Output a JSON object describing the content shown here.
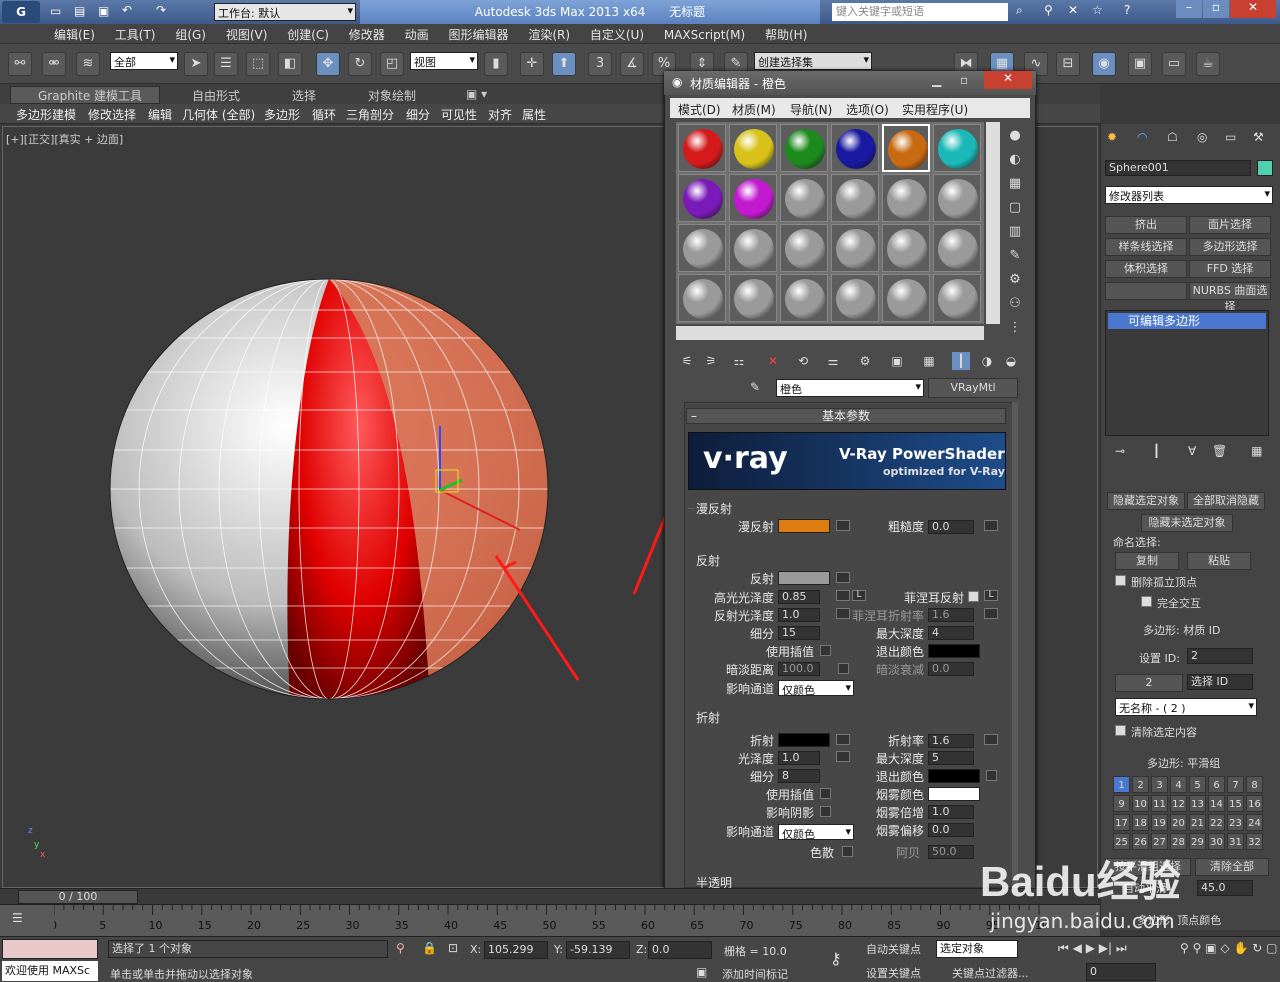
{
  "window": {
    "workspace_label": "工作台: 默认",
    "app_title": "Autodesk 3ds Max  2013 x64",
    "doc_title": "无标题",
    "search_placeholder": "键入关键字或短语"
  },
  "menu": [
    "编辑(E)",
    "工具(T)",
    "组(G)",
    "视图(V)",
    "创建(C)",
    "修改器",
    "动画",
    "图形编辑器",
    "渲染(R)",
    "自定义(U)",
    "MAXScript(M)",
    "帮助(H)"
  ],
  "toolbar": {
    "selection_filter": "全部",
    "ref_coord": "视图",
    "named_selection": "创建选择集",
    "snap_number": "3",
    "percent_label": "%"
  },
  "ribbon": {
    "tabs": [
      "Graphite 建模工具",
      "自由形式",
      "选择",
      "对象绘制"
    ],
    "tools": [
      "多边形建模",
      "修改选择",
      "编辑",
      "几何体 (全部)",
      "多边形",
      "循环",
      "三角剖分",
      "细分",
      "可见性",
      "对齐",
      "属性"
    ]
  },
  "viewport": {
    "label": "[+][正交][真实 + 边面]",
    "axis": {
      "x": "x",
      "y": "y",
      "z": "z"
    }
  },
  "material_editor": {
    "title": "材质编辑器 - 橙色",
    "menu": [
      "模式(D)",
      "材质(M)",
      "导航(N)",
      "选项(O)",
      "实用程序(U)"
    ],
    "slots": [
      {
        "color": "#d41a1a"
      },
      {
        "color": "#d8c21a"
      },
      {
        "color": "#1d8a1d"
      },
      {
        "color": "#1a1aa0"
      },
      {
        "color": "#c86a12",
        "selected": true
      },
      {
        "color": "#1ab8b8"
      },
      {
        "color": "#7a1ab8"
      },
      {
        "color": "#c21ad0"
      },
      {
        "color": "#9a9a9a"
      },
      {
        "color": "#9a9a9a"
      },
      {
        "color": "#9a9a9a"
      },
      {
        "color": "#9a9a9a"
      },
      {
        "color": "#9a9a9a"
      },
      {
        "color": "#9a9a9a"
      },
      {
        "color": "#9a9a9a"
      },
      {
        "color": "#9a9a9a"
      },
      {
        "color": "#9a9a9a"
      },
      {
        "color": "#9a9a9a"
      },
      {
        "color": "#9a9a9a"
      },
      {
        "color": "#9a9a9a"
      },
      {
        "color": "#9a9a9a"
      },
      {
        "color": "#9a9a9a"
      },
      {
        "color": "#9a9a9a"
      },
      {
        "color": "#9a9a9a"
      }
    ],
    "material_name": "橙色",
    "material_type": "VRayMtl",
    "rollout_title": "基本参数",
    "vray_banner": {
      "logo": "v·ray",
      "title": "V-Ray PowerShader",
      "subtitle": "optimized for V-Ray"
    },
    "diffuse": {
      "group": "漫反射",
      "diffuse_label": "漫反射",
      "diffuse_color": "#e07d10",
      "roughness_label": "粗糙度",
      "roughness": "0.0"
    },
    "reflection": {
      "group": "反射",
      "reflect_label": "反射",
      "reflect_color": "#9a9a9a",
      "hilight_gloss_label": "高光光泽度",
      "hilight_gloss": "0.85",
      "lock_label": "L",
      "fresnel_label": "菲涅耳反射",
      "refl_gloss_label": "反射光泽度",
      "refl_gloss": "1.0",
      "fresnel_ior_label": "菲涅耳折射率",
      "fresnel_ior": "1.6",
      "subdivs_label": "细分",
      "subdivs": "15",
      "max_depth_label": "最大深度",
      "max_depth": "4",
      "interp_label": "使用插值",
      "exit_color_label": "退出颜色",
      "exit_color": "#000000",
      "dim_dist_label": "暗淡距离",
      "dim_dist": "100.0",
      "dim_falloff_label": "暗淡衰减",
      "dim_falloff": "0.0",
      "affect_label": "影响通道",
      "affect": "仅颜色"
    },
    "refraction": {
      "group": "折射",
      "refract_label": "折射",
      "refract_color": "#000000",
      "ior_label": "折射率",
      "ior": "1.6",
      "gloss_label": "光泽度",
      "gloss": "1.0",
      "max_depth_label": "最大深度",
      "max_depth": "5",
      "subdivs_label": "细分",
      "subdivs": "8",
      "exit_color_label": "退出颜色",
      "exit_color": "#000000",
      "interp_label": "使用插值",
      "fog_color_label": "烟雾颜色",
      "fog_color": "#ffffff",
      "shadows_label": "影响阴影",
      "fog_mult_label": "烟雾倍增",
      "fog_mult": "1.0",
      "affect_label": "影响通道",
      "affect": "仅颜色",
      "fog_bias_label": "烟雾偏移",
      "fog_bias": "0.0",
      "dispersion_label": "色散",
      "abbe_label": "阿贝",
      "abbe": "50.0"
    },
    "next_group": "半透明"
  },
  "command_panel": {
    "object_name": "Sphere001",
    "object_color": "#4fd0b0",
    "modifier_list": "修改器列表",
    "mod_buttons": [
      "挤出",
      "面片选择",
      "样条线选择",
      "多边形选择",
      "体积选择",
      "FFD 选择",
      "",
      "NURBS 曲面选择"
    ],
    "stack_item": "可编辑多边形",
    "hide_selected": "隐藏选定对象",
    "unhide_all": "全部取消隐藏",
    "hide_unselected": "隐藏未选定对象",
    "named_sel": "命名选择:",
    "copy": "复制",
    "paste": "粘贴",
    "delete_isolated": "删除孤立顶点",
    "full_interact": "完全交互",
    "mat_id_title": "多边形: 材质 ID",
    "set_id_label": "设置 ID:",
    "set_id": "2",
    "select_id_label": "选择 ID",
    "select_id": "2",
    "name_drop": "无名称 - ( 2 )",
    "clear_sel": "清除选定内容",
    "smooth_title": "多边形: 平滑组",
    "smooth_groups": [
      "1",
      "2",
      "3",
      "4",
      "5",
      "6",
      "7",
      "8",
      "9",
      "10",
      "11",
      "12",
      "13",
      "14",
      "15",
      "16",
      "17",
      "18",
      "19",
      "20",
      "21",
      "22",
      "23",
      "24",
      "25",
      "26",
      "27",
      "28",
      "29",
      "30",
      "31",
      "32"
    ],
    "select_by_smooth": "按平滑组选择",
    "clear_all": "清除全部",
    "auto_smooth": "自动平滑",
    "auto_smooth_val": "45.0",
    "vertex_color_title": "多边形: 顶点颜色"
  },
  "timeline": {
    "frame": "0 / 100",
    "ticks": [
      "0",
      "5",
      "10",
      "15",
      "20",
      "25",
      "30",
      "35",
      "40",
      "45",
      "50",
      "55",
      "60",
      "65",
      "70",
      "75",
      "80",
      "85",
      "90",
      "95",
      "100"
    ]
  },
  "status": {
    "welcome": "欢迎使用 MAXSc",
    "selected": "选择了 1 个对象",
    "prompt": "单击或单击并拖动以选择对象",
    "x_label": "X:",
    "x": "105.299",
    "y_label": "Y:",
    "y": "-59.139",
    "z_label": "Z:",
    "z": "0.0",
    "grid": "栅格 = 10.0",
    "add_time_tag": "添加时间标记",
    "auto_key": "自动关键点",
    "selected_obj": "选定对象",
    "set_key": "设置关键点",
    "key_filters": "关键点过滤器...",
    "current_frame": "0"
  },
  "watermark": {
    "logo": "Baidu经验",
    "url": "jingyan.baidu.com"
  }
}
